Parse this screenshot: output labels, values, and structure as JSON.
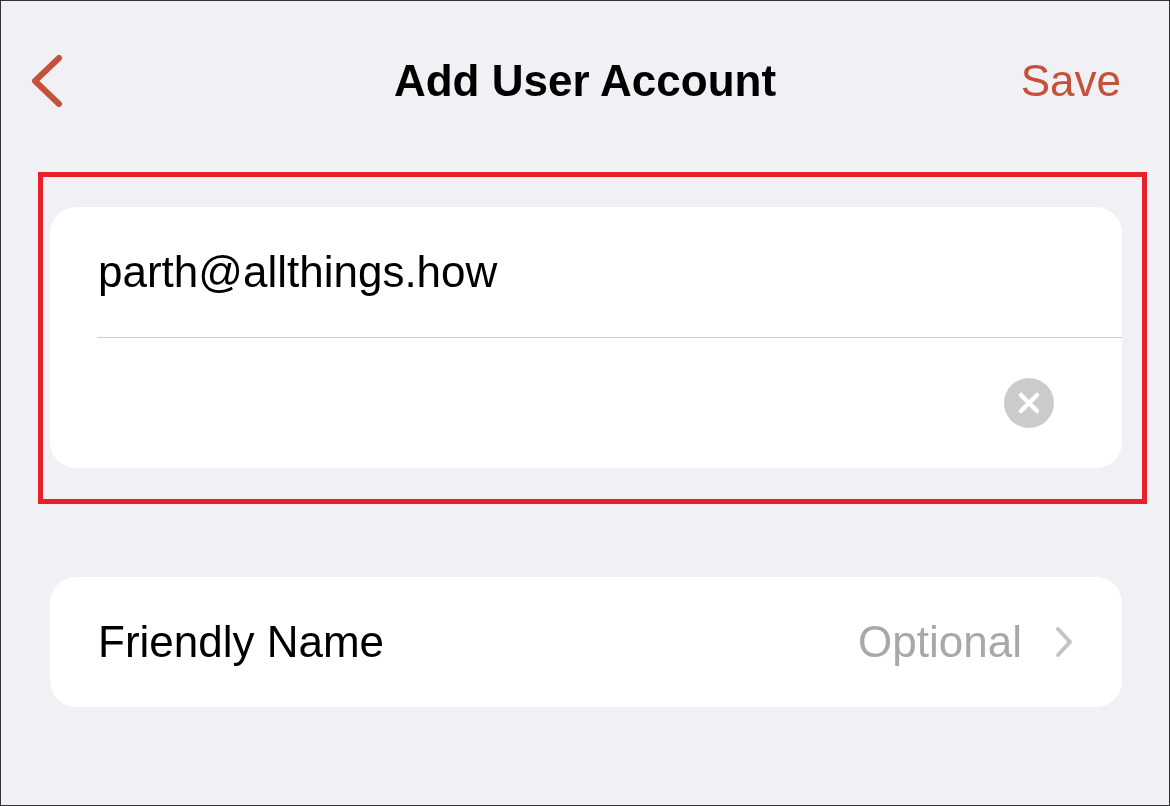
{
  "nav": {
    "title": "Add User Account",
    "action": "Save"
  },
  "account_card": {
    "highlighted": true,
    "rows": [
      {
        "kind": "text",
        "value": "parth@allthings.how"
      },
      {
        "kind": "clearable"
      }
    ]
  },
  "settings": [
    {
      "label": "Friendly Name",
      "placeholder": "Optional"
    }
  ]
}
